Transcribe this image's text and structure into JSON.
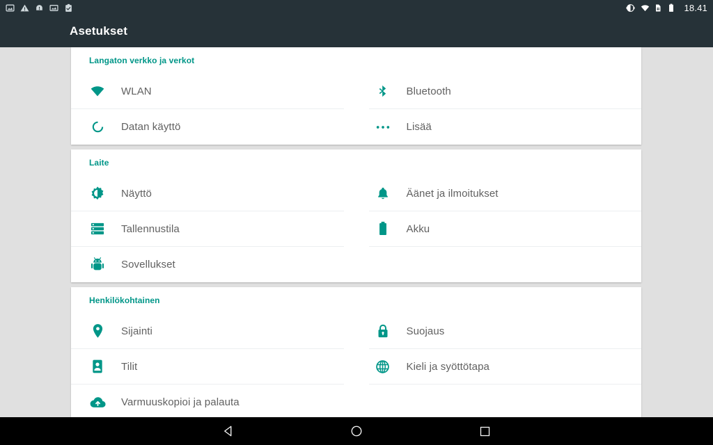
{
  "status_bar": {
    "left_icons": [
      {
        "name": "screenshot-icon",
        "glyph": "image"
      },
      {
        "name": "warning-icon",
        "glyph": "warning"
      },
      {
        "name": "alert-circle-icon",
        "glyph": "alert"
      },
      {
        "name": "picture-icon",
        "glyph": "picture"
      },
      {
        "name": "clipboard-check-icon",
        "glyph": "clipboard"
      }
    ],
    "right_icons": [
      {
        "name": "rotation-lock-icon",
        "glyph": "rotate"
      },
      {
        "name": "wifi-icon",
        "glyph": "wifi"
      },
      {
        "name": "sim-card-icon",
        "glyph": "sim"
      },
      {
        "name": "battery-full-icon",
        "glyph": "battery"
      }
    ],
    "clock": "18.41"
  },
  "app_bar": {
    "title": "Asetukset"
  },
  "colors": {
    "accent": "#009688",
    "app_bar_bg": "#263238",
    "page_bg": "#e0e0e0",
    "card_bg": "#ffffff",
    "label_text": "#616161",
    "divider": "#eceff1"
  },
  "sections": [
    {
      "id": "wireless",
      "header": "Langaton verkko ja verkot",
      "rows": [
        {
          "left": {
            "label": "WLAN",
            "icon": "wifi-icon"
          },
          "right": {
            "label": "Bluetooth",
            "icon": "bluetooth-icon"
          }
        },
        {
          "left": {
            "label": "Datan käyttö",
            "icon": "data-usage-icon"
          },
          "right": {
            "label": "Lisää",
            "icon": "more-horizontal-icon"
          }
        }
      ]
    },
    {
      "id": "device",
      "header": "Laite",
      "rows": [
        {
          "left": {
            "label": "Näyttö",
            "icon": "brightness-icon"
          },
          "right": {
            "label": "Äänet ja ilmoitukset",
            "icon": "bell-icon"
          }
        },
        {
          "left": {
            "label": "Tallennustila",
            "icon": "storage-icon"
          },
          "right": {
            "label": "Akku",
            "icon": "battery-icon"
          }
        },
        {
          "left": {
            "label": "Sovellukset",
            "icon": "android-robot-icon"
          },
          "right": null
        }
      ]
    },
    {
      "id": "personal",
      "header": "Henkilökohtainen",
      "rows": [
        {
          "left": {
            "label": "Sijainti",
            "icon": "location-pin-icon"
          },
          "right": {
            "label": "Suojaus",
            "icon": "lock-icon"
          }
        },
        {
          "left": {
            "label": "Tilit",
            "icon": "account-icon"
          },
          "right": {
            "label": "Kieli ja syöttötapa",
            "icon": "globe-icon"
          }
        },
        {
          "left": {
            "label": "Varmuuskopioi ja palauta",
            "icon": "backup-cloud-icon"
          },
          "right": null
        }
      ]
    }
  ],
  "nav_bar": {
    "buttons": [
      {
        "name": "back-button",
        "glyph": "triangle-left"
      },
      {
        "name": "home-button",
        "glyph": "circle"
      },
      {
        "name": "recents-button",
        "glyph": "square"
      }
    ]
  }
}
